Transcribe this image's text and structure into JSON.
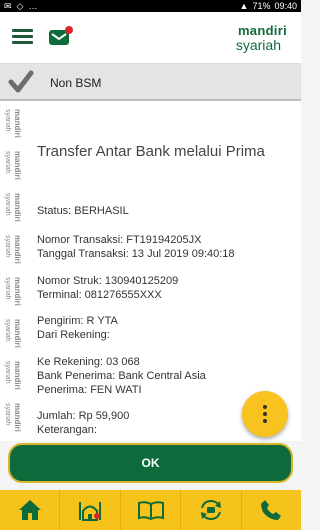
{
  "statusbar": {
    "time": "09:40",
    "battery": "71%"
  },
  "header": {
    "brand_top": "mandiri",
    "brand_bottom": "syariah"
  },
  "banner": {
    "label": "Non BSM"
  },
  "receipt": {
    "title": "Transfer Antar Bank melalui Prima",
    "status": "Status: BERHASIL",
    "transaction_number": "Nomor Transaksi: FT19194205JX",
    "transaction_date": "Tanggal Transaksi: 13 Jul 2019 09:40:18",
    "receipt_number": "Nomor Struk: 130940125209",
    "terminal": "Terminal: 081276555XXX",
    "sender": "Pengirim: R        YTA",
    "from_account": "Dari Rekening: ",
    "to_account": "Ke Rekening: 03        068",
    "recipient_bank": "Bank Penerima: Bank Central Asia",
    "recipient": "Penerima: FEN     WATI",
    "amount": "Jumlah: Rp 59,900",
    "note": "Keterangan:"
  },
  "watermark": {
    "line1": "mandiri",
    "line2": "syariah"
  },
  "actions": {
    "ok_label": "OK"
  },
  "navbar": {
    "items": [
      "home-icon",
      "mosque-icon",
      "book-icon",
      "transfer-icon",
      "phone-icon"
    ]
  },
  "colors": {
    "primary_green": "#0d6b3b",
    "accent_yellow": "#f6c31d",
    "notification_red": "#d9262b"
  }
}
